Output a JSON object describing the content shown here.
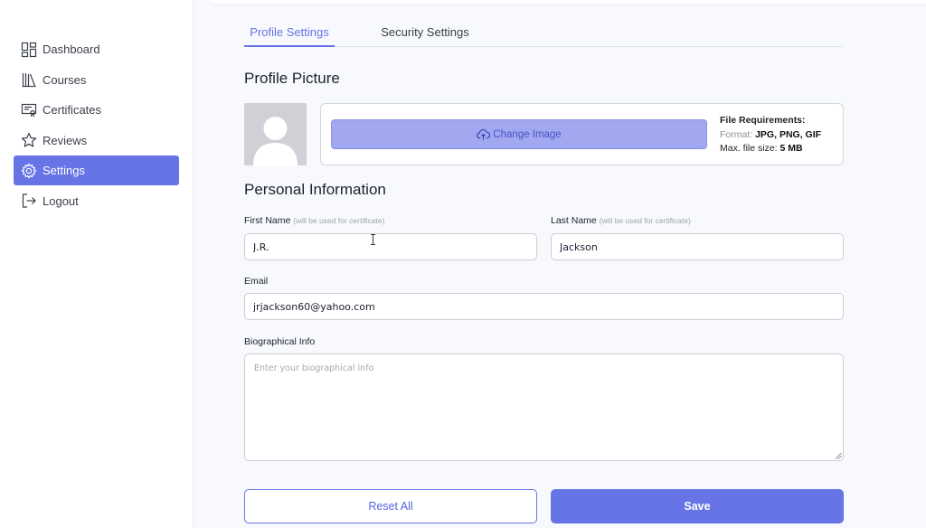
{
  "sidebar": {
    "items": [
      {
        "label": "Dashboard",
        "icon": "dashboard-icon",
        "active": false
      },
      {
        "label": "Courses",
        "icon": "books-icon",
        "active": false
      },
      {
        "label": "Certificates",
        "icon": "certificate-icon",
        "active": false
      },
      {
        "label": "Reviews",
        "icon": "star-icon",
        "active": false
      },
      {
        "label": "Settings",
        "icon": "gear-icon",
        "active": true
      },
      {
        "label": "Logout",
        "icon": "logout-icon",
        "active": false
      }
    ]
  },
  "tabs": [
    {
      "label": "Profile Settings",
      "active": true
    },
    {
      "label": "Security Settings",
      "active": false
    }
  ],
  "profile_picture": {
    "title": "Profile Picture",
    "change_button": "Change Image",
    "requirements": {
      "heading": "File Requirements:",
      "format_label": "Format:",
      "format_value": "JPG, PNG, GIF",
      "size_label": "Max. file size:",
      "size_value": "5 MB"
    }
  },
  "personal": {
    "title": "Personal Information",
    "first_name": {
      "label": "First Name",
      "hint": "(will be used for certificate)",
      "value": "J.R."
    },
    "last_name": {
      "label": "Last Name",
      "hint": "(will be used for certificate)",
      "value": "Jackson"
    },
    "email": {
      "label": "Email",
      "value": "jrjackson60@yahoo.com"
    },
    "bio": {
      "label": "Biographical Info",
      "placeholder": "Enter your biographical info"
    }
  },
  "actions": {
    "reset": "Reset All",
    "save": "Save"
  },
  "colors": {
    "accent": "#6674e6",
    "accent_light": "#a1a8ef",
    "background": "#f8f9fd"
  }
}
